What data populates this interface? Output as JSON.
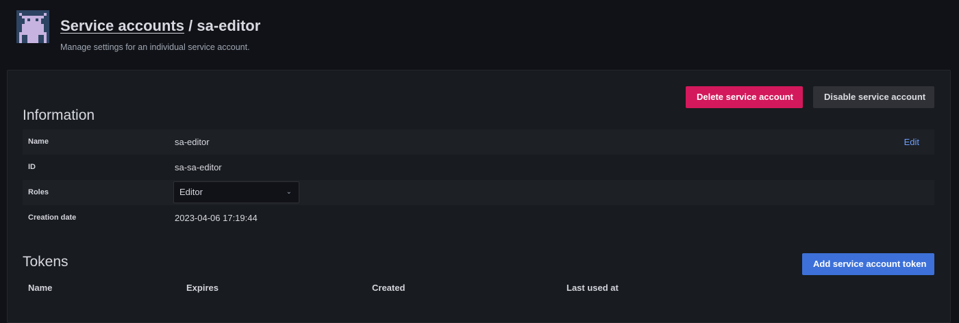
{
  "header": {
    "breadcrumb_link": "Service accounts",
    "separator": "/",
    "account_name": "sa-editor",
    "subtitle": "Manage settings for an individual service account."
  },
  "actions": {
    "delete_label": "Delete service account",
    "disable_label": "Disable service account"
  },
  "information": {
    "title": "Information",
    "rows": [
      {
        "label": "Name",
        "value": "sa-editor",
        "action": "Edit"
      },
      {
        "label": "ID",
        "value": "sa-sa-editor"
      },
      {
        "label": "Roles",
        "value": "Editor"
      },
      {
        "label": "Creation date",
        "value": "2023-04-06 17:19:44"
      }
    ]
  },
  "tokens": {
    "title": "Tokens",
    "add_label": "Add service account token",
    "columns": [
      "Name",
      "Expires",
      "Created",
      "Last used at"
    ]
  },
  "colors": {
    "background": "#111217",
    "panel": "#181b1f",
    "danger": "#d3195b",
    "primary": "#3d71d9",
    "link": "#6e9fff"
  },
  "icons": {
    "avatar": "robot-avatar-icon",
    "select_chevron": "chevron-down-icon"
  }
}
